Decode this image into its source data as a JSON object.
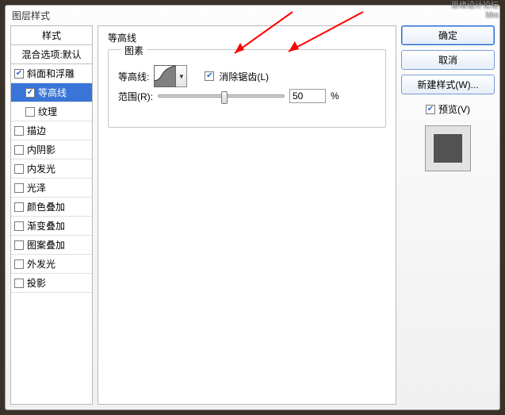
{
  "dialog": {
    "title": "图层样式"
  },
  "styles": {
    "header": "样式",
    "blend": "混合选项:默认",
    "items": [
      {
        "label": "斜面和浮雕",
        "checked": true,
        "indent": false,
        "selected": false
      },
      {
        "label": "等高线",
        "checked": true,
        "indent": true,
        "selected": true
      },
      {
        "label": "纹理",
        "checked": false,
        "indent": true,
        "selected": false
      },
      {
        "label": "描边",
        "checked": false,
        "indent": false,
        "selected": false
      },
      {
        "label": "内阴影",
        "checked": false,
        "indent": false,
        "selected": false
      },
      {
        "label": "内发光",
        "checked": false,
        "indent": false,
        "selected": false
      },
      {
        "label": "光泽",
        "checked": false,
        "indent": false,
        "selected": false
      },
      {
        "label": "颜色叠加",
        "checked": false,
        "indent": false,
        "selected": false
      },
      {
        "label": "渐变叠加",
        "checked": false,
        "indent": false,
        "selected": false
      },
      {
        "label": "图案叠加",
        "checked": false,
        "indent": false,
        "selected": false
      },
      {
        "label": "外发光",
        "checked": false,
        "indent": false,
        "selected": false
      },
      {
        "label": "投影",
        "checked": false,
        "indent": false,
        "selected": false
      }
    ]
  },
  "content": {
    "section_title": "等高线",
    "fieldset_legend": "图素",
    "contour_label": "等高线:",
    "antialias_label": "消除锯齿(L)",
    "antialias_checked": true,
    "range_label": "范围(R):",
    "range_value": "50",
    "range_unit": "%"
  },
  "buttons": {
    "ok": "确定",
    "cancel": "取消",
    "new_style": "新建样式(W)...",
    "preview_label": "预览(V)",
    "preview_checked": true
  },
  "watermark": {
    "line1": "思缘设计论坛",
    "line2": "bbs"
  }
}
